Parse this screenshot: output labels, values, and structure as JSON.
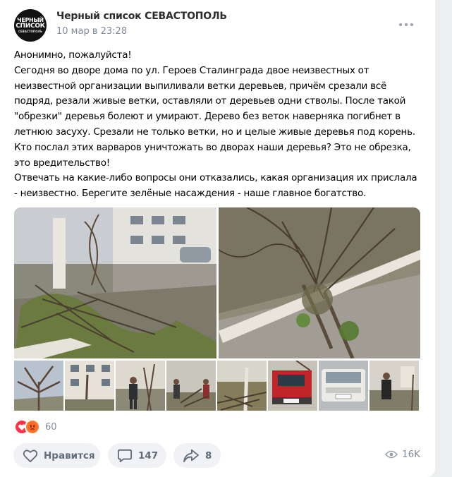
{
  "post": {
    "author": "Черный список СЕВАСТОПОЛЬ",
    "date": "10 мар в 23:28",
    "avatar_text": [
      "ЧЕРНЫЙ",
      "СПИСОК",
      "СЕВАСТОПОЛЬ"
    ],
    "text_lines": [
      "Анонимно, пожалуйста!",
      "Сегодня во дворе дома по ул. Героев Сталинграда двое неизвестных от",
      "неизвестной организации выпиливали ветки деревьев, причём срезали всё",
      "подряд, резали живые ветки, оставляли от деревьев одни стволы. После такой",
      "\"обрезки\" деревья болеют и умирают. Дерево без веток наверняка погибнет в",
      "летнюю засуху. Срезали не только ветки, но и целые живые деревья под корень.",
      "Кто послал этих варваров уничтожать во дворах наши деревья? Это не обрезка,",
      "это вредительство!",
      "Отвечать на какие-либо вопросы они отказались, какая организация их прислала",
      "- неизвестно. Берегите зелёные насаждения - наше главное богатство."
    ],
    "photos": {
      "main": [
        "photo-yard-cut-branches",
        "photo-fallen-tree"
      ],
      "thumbnails": [
        "photo-tree",
        "photo-building",
        "photo-worker",
        "photo-workers-branches",
        "photo-cut-trunk",
        "photo-red-truck",
        "photo-white-van",
        "photo-man-yard"
      ]
    }
  },
  "reactions": {
    "icons": [
      "heart-icon",
      "angry-face-icon"
    ],
    "count": "60"
  },
  "actions": {
    "like_label": "Нравится",
    "comments_count": "147",
    "shares_count": "8",
    "views_count": "16K"
  },
  "colors": {
    "accent": "#ff3347",
    "muted": "#818c99",
    "button_bg": "#f0f2f5"
  }
}
